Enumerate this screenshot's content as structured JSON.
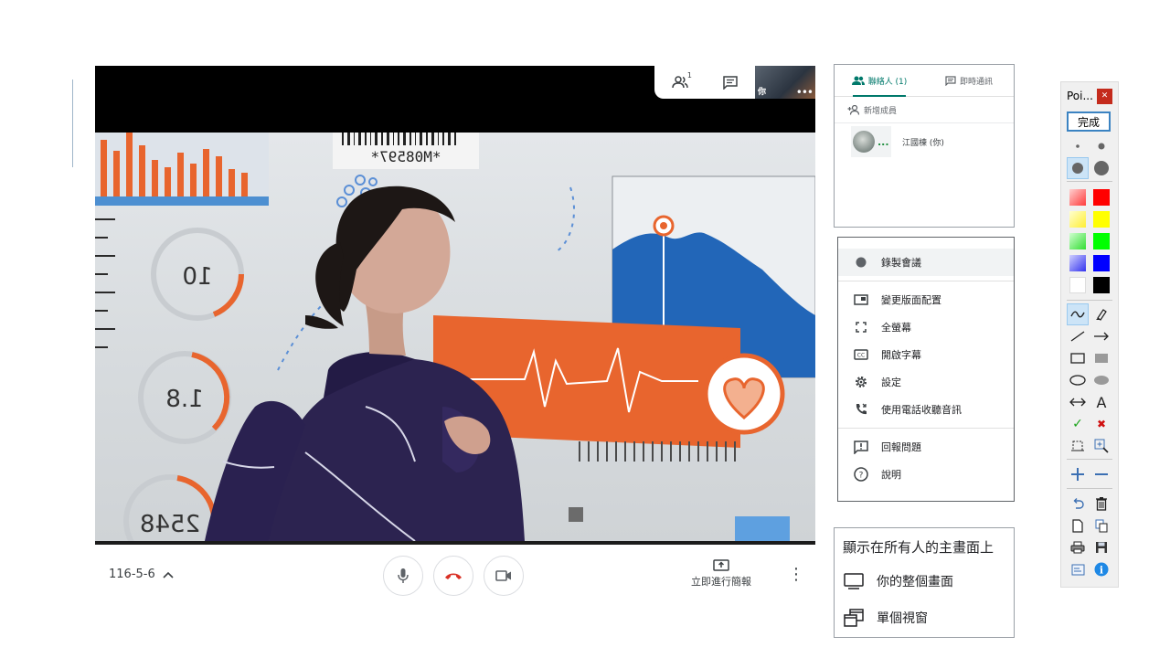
{
  "meeting": {
    "code": "116-5-6",
    "participant_count": "1",
    "self_label": "你",
    "present_label": "立即進行簡報"
  },
  "people_panel": {
    "tab_people": "聯絡人 (1)",
    "tab_chat": "即時通訊",
    "add_member": "新增成員",
    "participants": [
      {
        "name": "江國棟 (你)"
      }
    ]
  },
  "menu": {
    "items": [
      {
        "label": "錄製會議",
        "icon": "record-dot-icon"
      },
      {
        "label": "變更版面配置",
        "icon": "layout-icon"
      },
      {
        "label": "全螢幕",
        "icon": "fullscreen-icon"
      },
      {
        "label": "開啟字幕",
        "icon": "captions-icon"
      },
      {
        "label": "設定",
        "icon": "gear-icon"
      },
      {
        "label": "使用電話收聽音訊",
        "icon": "phone-icon"
      },
      {
        "label": "回報問題",
        "icon": "feedback-icon"
      },
      {
        "label": "說明",
        "icon": "help-icon"
      }
    ]
  },
  "share_panel": {
    "title": "顯示在所有人的主畫面上",
    "options": [
      {
        "label": "你的整個畫面",
        "icon": "monitor-icon"
      },
      {
        "label": "單個視窗",
        "icon": "window-icon"
      }
    ]
  },
  "pointer_toolbar": {
    "title": "Poi...",
    "done_label": "完成",
    "colors": [
      "#ff6b6b",
      "#ff0000",
      "#ffff66",
      "#ffff00",
      "#66ff66",
      "#00ff00",
      "#6666ff",
      "#0000ff",
      "#ffffff",
      "#000000"
    ]
  },
  "video_poster": {
    "barcode_text": "*M08597*",
    "gauge_1": "10",
    "gauge_2": "1.8",
    "gauge_3": "2548"
  }
}
